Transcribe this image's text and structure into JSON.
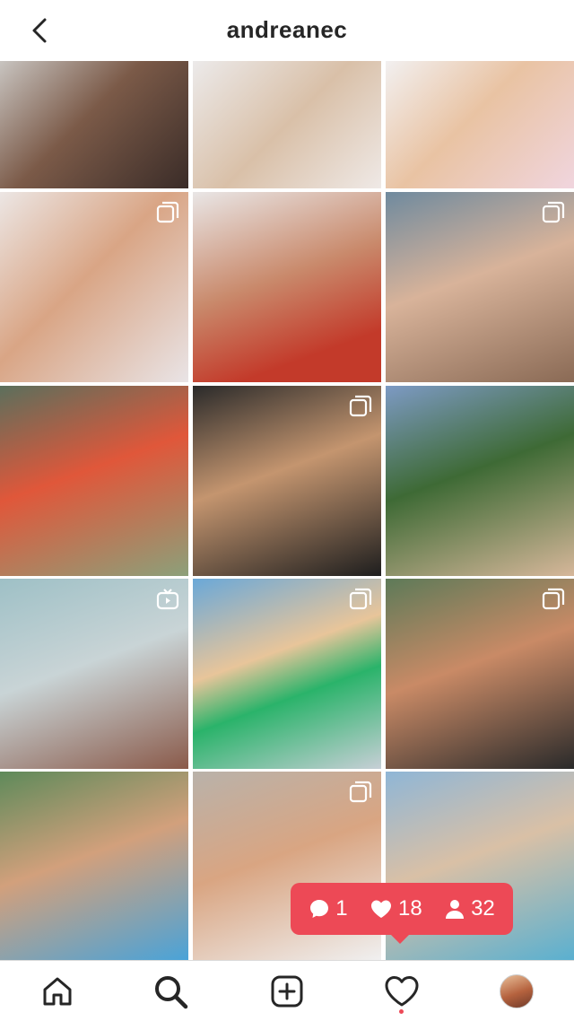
{
  "header": {
    "title": "andreanec"
  },
  "grid": {
    "tiles": [
      {
        "bg": "linear-gradient(135deg,#c8c4c0,#7b5a48 45%,#3a2c28)",
        "badge": "none"
      },
      {
        "bg": "linear-gradient(135deg,#eceaea,#d9c0a8 50%,#efe9e6)",
        "badge": "none"
      },
      {
        "bg": "linear-gradient(135deg,#f2f0f0,#e9c3a3 45%,#f0d5de)",
        "badge": "none"
      },
      {
        "bg": "linear-gradient(135deg,#ece6e4,#d9a585 45%,#e9e4e6)",
        "badge": "multiple"
      },
      {
        "bg": "linear-gradient(160deg,#e9e6e6,#c98a6c 45%,#c33a2a 80%)",
        "badge": "none"
      },
      {
        "bg": "linear-gradient(160deg,#6f8a9e,#d8b39a 45%,#8a6a55)",
        "badge": "multiple"
      },
      {
        "bg": "linear-gradient(160deg,#5b6f5c,#e0573a 45%,#8ca07a)",
        "badge": "none"
      },
      {
        "bg": "linear-gradient(160deg,#2a2a2a,#c4956f 45%,#1e1e1e)",
        "badge": "multiple"
      },
      {
        "bg": "linear-gradient(160deg,#7d9ac4,#3e6a35 45%,#d6b79a)",
        "badge": "none"
      },
      {
        "bg": "linear-gradient(160deg,#9ec0c6,#c9d4d6 45%,#8a5a4a)",
        "badge": "igtv"
      },
      {
        "bg": "linear-gradient(160deg,#6aa8d8,#e8c59a 40%,#2ab36a 60%,#c7cfd6)",
        "badge": "multiple"
      },
      {
        "bg": "linear-gradient(160deg,#5d7a58,#c98a66 45%,#2a2a2a)",
        "badge": "multiple"
      },
      {
        "bg": "linear-gradient(160deg,#5e8a5a,#d2a07c 45%,#4aa3d8)",
        "badge": "none"
      },
      {
        "bg": "linear-gradient(160deg,#b9b2aa,#d9a582 45%,#f0f0f0)",
        "badge": "multiple"
      },
      {
        "bg": "linear-gradient(160deg,#8fb6d6,#d9c0a6 45%,#5ab0d0)",
        "badge": "none"
      }
    ]
  },
  "activity": {
    "comments": "1",
    "likes": "18",
    "follows": "32"
  },
  "nav": {
    "items": [
      {
        "icon": "home-icon"
      },
      {
        "icon": "search-icon"
      },
      {
        "icon": "add-post-icon"
      },
      {
        "icon": "heart-icon"
      },
      {
        "icon": "profile-avatar"
      }
    ]
  }
}
